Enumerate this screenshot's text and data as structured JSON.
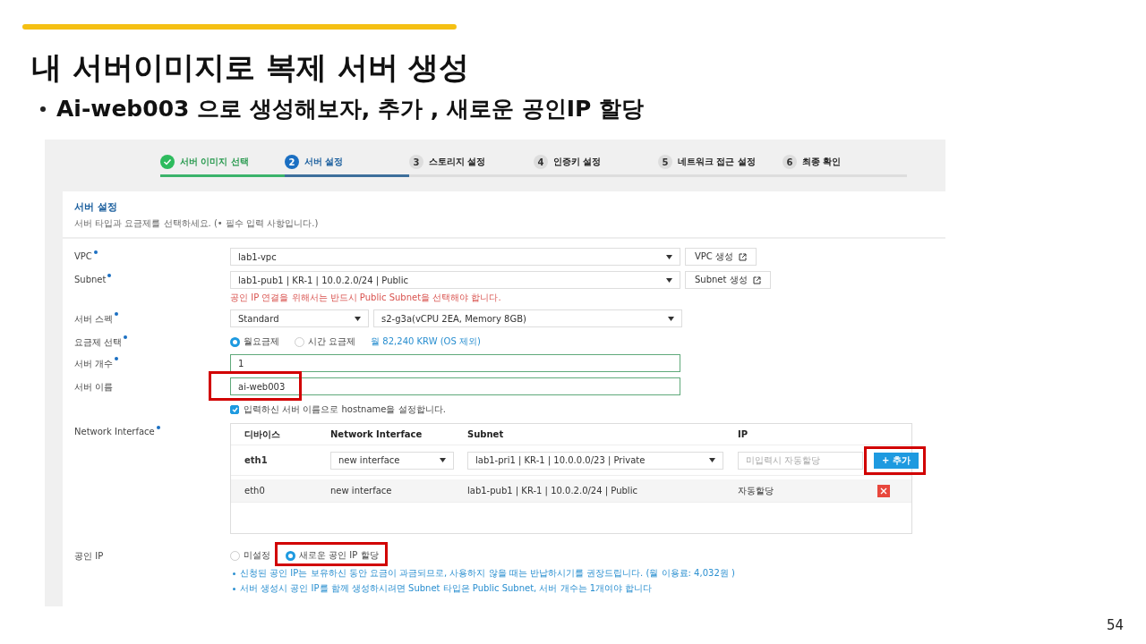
{
  "slide": {
    "title": "내 서버이미지로 복제 서버 생성",
    "bullet": "Ai-web003 으로 생성해보자, 추가 , 새로운 공인IP 할당",
    "page_number": "54"
  },
  "steps": [
    {
      "label": "서버 이미지 선택",
      "kind": "done"
    },
    {
      "number": "2",
      "label": "서버 설정",
      "kind": "current"
    },
    {
      "number": "3",
      "label": "스토리지 설정",
      "kind": "pending"
    },
    {
      "number": "4",
      "label": "인증키 설정",
      "kind": "pending"
    },
    {
      "number": "5",
      "label": "네트워크 접근 설정",
      "kind": "pending"
    },
    {
      "number": "6",
      "label": "최종 확인",
      "kind": "pending"
    }
  ],
  "section": {
    "title": "서버 설정",
    "description": "서버 타입과 요금제를 선택하세요. (• 필수 입력 사항입니다.)"
  },
  "fields": [
    {
      "kind": "select",
      "label": "VPC",
      "required": true,
      "value": "lab1-vpc",
      "button": "VPC 생성"
    },
    {
      "kind": "select",
      "label": "Subnet",
      "required": true,
      "value": "lab1-pub1 | KR-1 | 10.0.2.0/24 | Public",
      "button": "Subnet 생성",
      "error": "공인 IP 연결을 위해서는 반드시 Public Subnet을 선택해야 합니다."
    },
    {
      "kind": "spec",
      "label": "서버 스펙",
      "required": true,
      "values": [
        "Standard",
        "s2-g3a(vCPU 2EA, Memory 8GB)"
      ]
    },
    {
      "kind": "radio",
      "label": "요금제 선택",
      "required": true,
      "options": [
        {
          "label": "월요금제",
          "selected": true
        },
        {
          "label": "시간 요금제",
          "selected": false
        }
      ],
      "note": "월 82,240 KRW (OS 제외)"
    },
    {
      "kind": "input",
      "label": "서버 개수",
      "required": true,
      "value": "1"
    },
    {
      "kind": "input",
      "label": "서버 이름",
      "required": false,
      "value": "ai-web003",
      "highlighted": true,
      "checkbox": {
        "label": "입력하신 서버 이름으로 hostname을 설정합니다.",
        "checked": true
      }
    },
    {
      "kind": "table",
      "label": "Network Interface",
      "required": true,
      "columns": [
        "디바이스",
        "Network Interface",
        "Subnet",
        "IP"
      ],
      "edit_row": {
        "device": "eth1",
        "interface": "new interface",
        "subnet": "lab1-pri1 | KR-1 | 10.0.0.0/23 | Private",
        "ip_placeholder": "미입력시 자동할당",
        "button": "+ 추가",
        "highlighted": true
      },
      "rows": [
        {
          "device": "eth0",
          "interface": "new interface",
          "subnet": "lab1-pub1 | KR-1 | 10.0.2.0/24 | Public",
          "ip": "자동할당"
        }
      ]
    },
    {
      "kind": "radio",
      "label": "공인 IP",
      "required": false,
      "options": [
        {
          "label": "미설정",
          "selected": false
        },
        {
          "label": "새로운 공인 IP 할당",
          "selected": true,
          "highlighted": true
        }
      ],
      "notes": [
        "신청된 공인 IP는 보유하신 동안 요금이 과금되므로, 사용하지 않을 때는 반납하시기를 권장드립니다. (월 이용료: 4,032원 )",
        "서버 생성시 공인 IP를 함께 생성하시려면 Subnet 타입은 Public Subnet, 서버 개수는 1개여야 합니다"
      ]
    }
  ]
}
